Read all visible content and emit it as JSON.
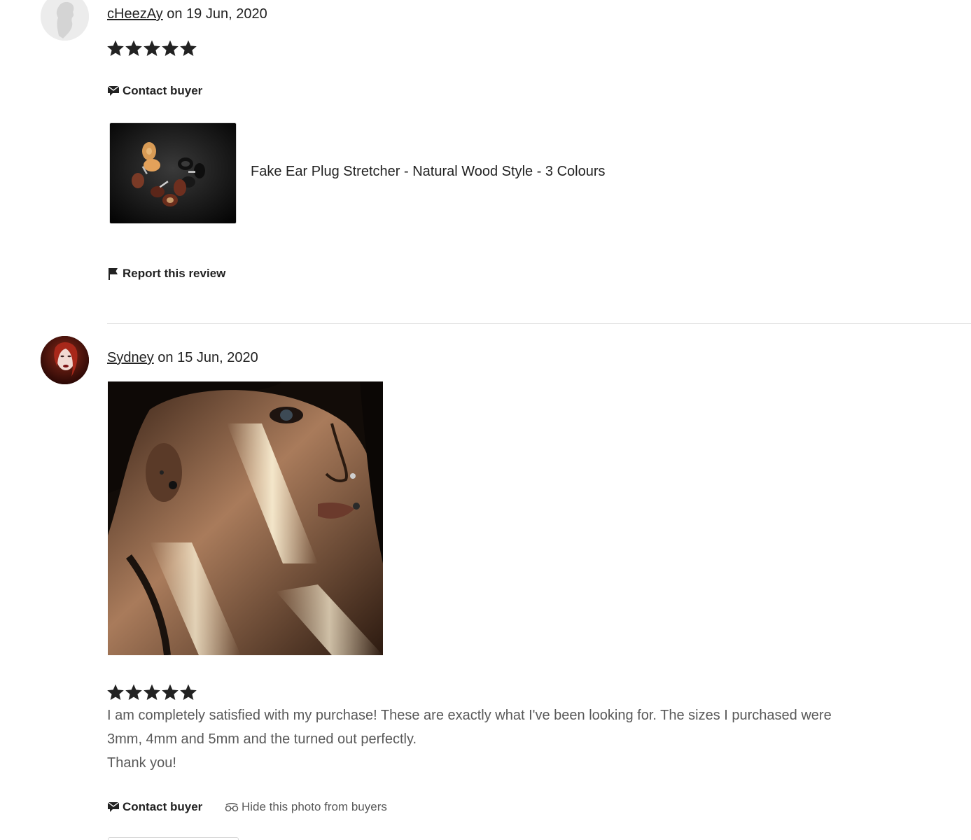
{
  "reviews": [
    {
      "username": "cHeezAy",
      "date_text": " on 19 Jun, 2020",
      "rating": 5,
      "actions": {
        "contact": "Contact buyer"
      },
      "product": {
        "title": "Fake Ear Plug Stretcher - Natural Wood Style - 3 Colours"
      },
      "report": "Report this review",
      "avatar": "default-silhouette-avatar"
    },
    {
      "username": "Sydney",
      "date_text": " on 15 Jun, 2020",
      "rating": 5,
      "text_lines": [
        "I am completely satisfied with my purchase! These are exactly what I've been looking for. The sizes I purchased were",
        "3mm, 4mm and 5mm and the turned out perfectly.",
        "Thank you!"
      ],
      "actions": {
        "contact": "Contact buyer",
        "hide_photo": "Hide this photo from buyers"
      },
      "avatar": "photo-avatar"
    }
  ],
  "colors": {
    "text": "#222222",
    "muted_text": "#595959",
    "divider": "#d9d9d9",
    "star": "#222222"
  }
}
